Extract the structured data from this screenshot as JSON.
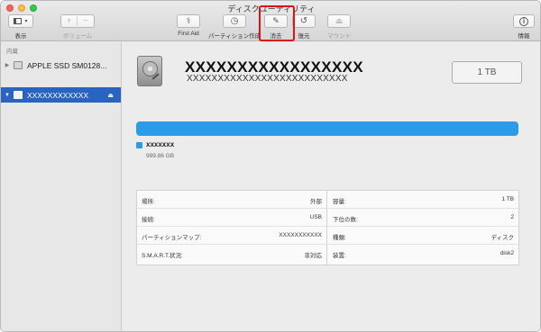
{
  "window": {
    "title": "ディスクユーティリティ"
  },
  "toolbar": {
    "view_label": "表示",
    "volume_label": "ボリューム",
    "firstaid_label": "First Aid",
    "partition_label": "パーティション作成",
    "erase_label": "消去",
    "restore_label": "復元",
    "mount_label": "マウント",
    "info_label": "情報"
  },
  "sidebar": {
    "section_header": "内蔵",
    "items": [
      {
        "label": "APPLE SSD SM0128..."
      },
      {
        "label": "XXXXXXXXXXXX"
      }
    ]
  },
  "main": {
    "volume_name": "XXXXXXXXXXXXXXXXX",
    "volume_subtitle": "XXXXXXXXXXXXXXXXXXXXXXXXXX",
    "capacity_badge": "1 TB",
    "usage": {
      "partition_name": "xxxxxxx",
      "partition_size": "999.86 GB",
      "fill_fraction": 1.0,
      "color": "#2c9ce8"
    },
    "info_left": [
      {
        "key": "場所:",
        "value": "外部"
      },
      {
        "key": "接続:",
        "value": "USB"
      },
      {
        "key": "パーティションマップ:",
        "value": "XXXXXXXXXXX"
      },
      {
        "key": "S.M.A.R.T.状況:",
        "value": "非対応"
      }
    ],
    "info_right": [
      {
        "key": "容量:",
        "value": "1 TB"
      },
      {
        "key": "下位の数:",
        "value": "2"
      },
      {
        "key": "種類:",
        "value": "ディスク"
      },
      {
        "key": "装置:",
        "value": "disk2"
      }
    ]
  },
  "highlight_color": "#d9141e"
}
